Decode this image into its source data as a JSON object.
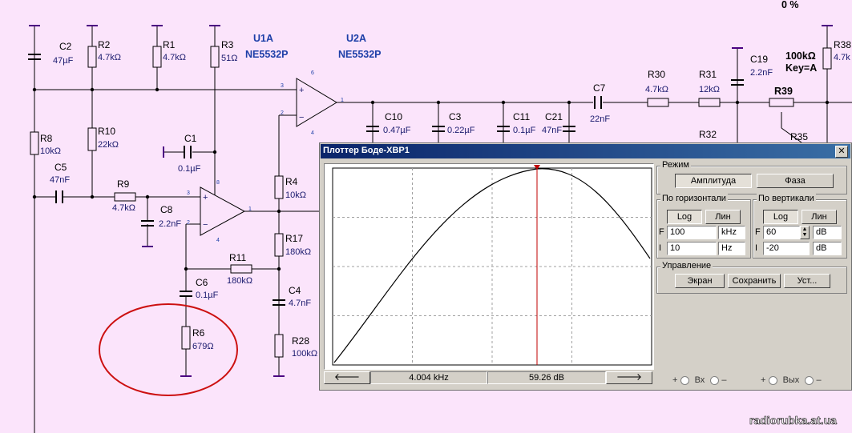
{
  "schematic": {
    "percent": "0 %",
    "chips": {
      "u1": "U1A",
      "u1_model": "NE5532P",
      "u2": "U2A",
      "u2_model": "NE5532P"
    },
    "parts": {
      "c2": "C2",
      "c2v": "47µF",
      "r2": "R2",
      "r2v": "4.7kΩ",
      "r1": "R1",
      "r1v": "4.7kΩ",
      "r3": "R3",
      "r3v": "51Ω",
      "r8": "R8",
      "r8v": "10kΩ",
      "r10": "R10",
      "r10v": "22kΩ",
      "c5": "C5",
      "c5v": "47nF",
      "c1": "C1",
      "c1v": "0.1µF",
      "r9": "R9",
      "r9v": "4.7kΩ",
      "c8": "C8",
      "c8v": "2.2nF",
      "r11": "R11",
      "r11v": "180kΩ",
      "c6": "C6",
      "c6v": "0.1µF",
      "r6": "R6",
      "r6v": "679Ω",
      "r4": "R4",
      "r4v": "10kΩ",
      "r17": "R17",
      "r17v": "180kΩ",
      "c4": "C4",
      "c4v": "4.7nF",
      "r28": "R28",
      "r28v": "100kΩ",
      "c10": "C10",
      "c10v": "0.47µF",
      "c3": "C3",
      "c3v": "0.22µF",
      "c11": "C11",
      "c11v": "0.1µF",
      "c21": "C21",
      "c21v": "47nF",
      "c7": "C7",
      "c7v": "22nF",
      "r30": "R30",
      "r30v": "4.7kΩ",
      "r31": "R31",
      "r31v": "12kΩ",
      "r32": "R32",
      "c19": "C19",
      "c19v": "2.2nF",
      "r39": "R39",
      "r39v": "100kΩ",
      "key": "Key=A",
      "r35": "R35",
      "r38": "R38",
      "r38v": "4.7k"
    },
    "pins": [
      "3",
      "2",
      "6",
      "4",
      "1",
      "8",
      "3",
      "2",
      "1",
      "4"
    ],
    "watermark": "radiorubka.at.ua"
  },
  "bode": {
    "title": "Плоттер Боде-XBP1",
    "close": "✕",
    "nav": {
      "left": "🡐",
      "right": "🡒",
      "freq": "4.004 kHz",
      "gain": "59.26 dB"
    },
    "mode": {
      "title": "Режим",
      "amplitude": "Амплитуда",
      "phase": "Фаза"
    },
    "horizontal": {
      "title": "По горизонтали",
      "log": "Log",
      "lin": "Лин",
      "f_label": "F",
      "f_value": "100",
      "f_unit": "kHz",
      "i_label": "I",
      "i_value": "10",
      "i_unit": "Hz"
    },
    "vertical": {
      "title": "По вертикали",
      "log": "Log",
      "lin": "Лин",
      "f_label": "F",
      "f_value": "60",
      "f_unit": "dB",
      "i_label": "I",
      "i_value": "-20",
      "i_unit": "dB"
    },
    "control": {
      "title": "Управление",
      "screen": "Экран",
      "save": "Сохранить",
      "setup": "Уст..."
    },
    "io": {
      "plus1": "+",
      "minus1": "–",
      "in": "Вх",
      "plus2": "+",
      "minus2": "–",
      "out": "Вых"
    }
  }
}
